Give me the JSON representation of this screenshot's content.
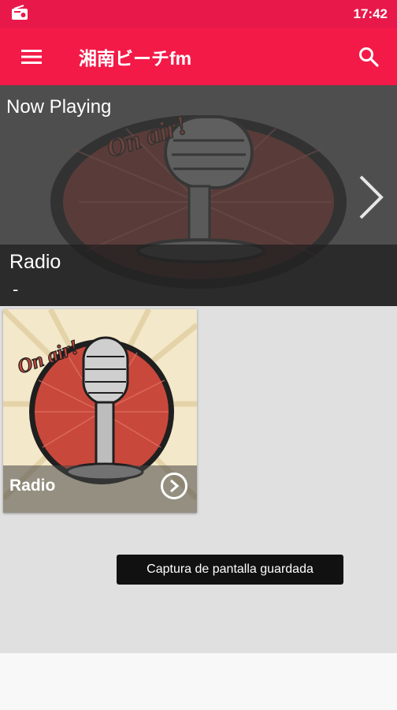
{
  "status_bar": {
    "time": "17:42",
    "left_icon": "radio-icon"
  },
  "app_bar": {
    "title": "湘南ビーチfm",
    "menu_icon": "hamburger-menu-icon",
    "search_icon": "search-icon"
  },
  "now_playing": {
    "heading": "Now Playing",
    "station": "Radio",
    "subtitle": "-",
    "art_lettering": "On air!",
    "next_icon": "chevron-right-icon"
  },
  "stations": [
    {
      "label": "Radio",
      "art_lettering": "On air!",
      "play_icon": "play-circle-icon"
    }
  ],
  "toast": {
    "message": "Captura de pantalla guardada"
  },
  "colors": {
    "status_bar": "#e8194a",
    "app_bar": "#f41a48",
    "background": "#e0e0e0",
    "card_background": "#f2e6c7",
    "toast": "#111111",
    "art_red": "#c24a3a"
  }
}
